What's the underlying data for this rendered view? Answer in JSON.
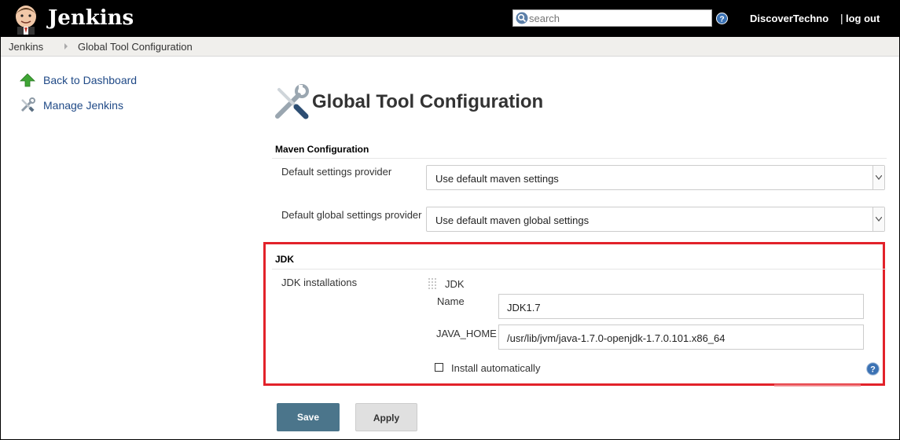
{
  "header": {
    "app_title": "Jenkins",
    "search_placeholder": "search",
    "user": "DiscoverTechno",
    "separator": "|",
    "logout": "log out"
  },
  "breadcrumb": {
    "items": [
      "Jenkins",
      "Global Tool Configuration"
    ]
  },
  "sidebar": {
    "items": [
      {
        "label": "Back to Dashboard",
        "icon": "up-arrow-icon"
      },
      {
        "label": "Manage Jenkins",
        "icon": "tools-icon"
      }
    ]
  },
  "main": {
    "title": "Global Tool Configuration",
    "maven": {
      "heading": "Maven Configuration",
      "default_settings_label": "Default settings provider",
      "default_settings_value": "Use default maven settings",
      "default_global_settings_label": "Default global settings provider",
      "default_global_settings_value": "Use default maven global settings"
    },
    "jdk": {
      "heading": "JDK",
      "installations_label": "JDK installations",
      "entry_title": "JDK",
      "name_label": "Name",
      "name_value": "JDK1.7",
      "java_home_label": "JAVA_HOME",
      "java_home_value": "/usr/lib/jvm/java-1.7.0-openjdk-1.7.0.101.x86_64",
      "install_auto_label": "Install automatically",
      "install_auto_checked": false
    },
    "buttons": {
      "save": "Save",
      "apply": "Apply"
    }
  },
  "colors": {
    "header_bg": "#000000",
    "link": "#204a87",
    "highlight": "#e2222a",
    "save_button": "#4b758b"
  }
}
